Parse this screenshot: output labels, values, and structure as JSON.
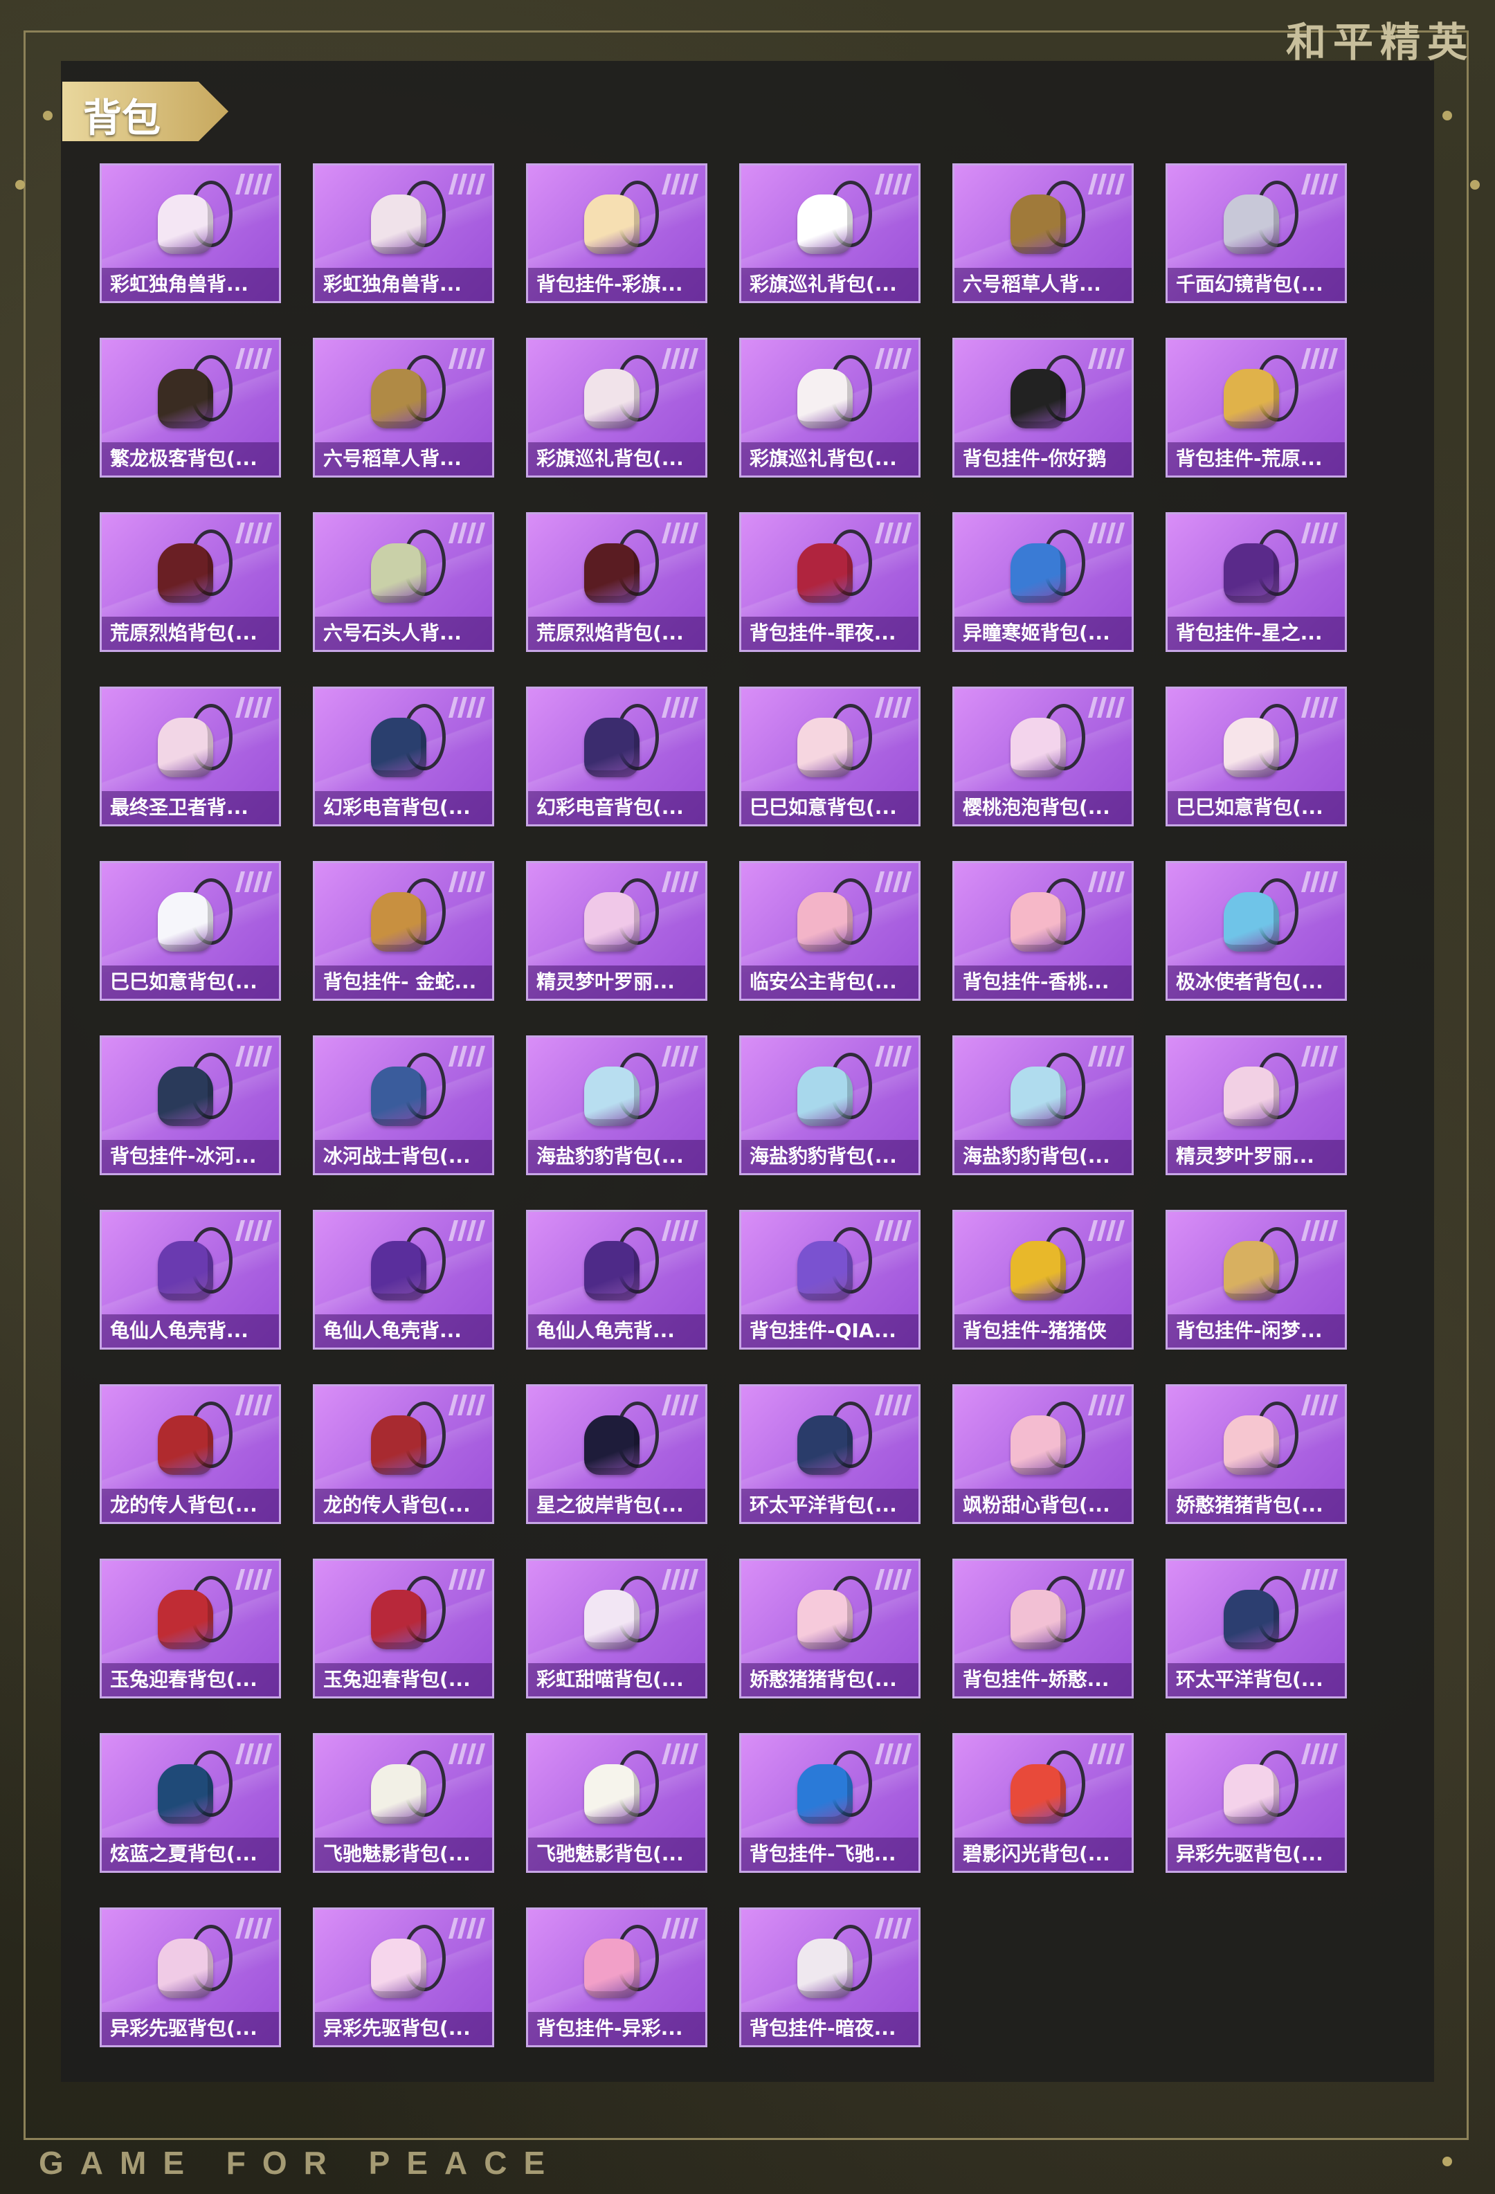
{
  "brand_cn": "和平精英",
  "footer_en": "GAME FOR PEACE",
  "section": {
    "title": "背包"
  },
  "colors": {
    "card_top": "#d98ef7",
    "card_bottom": "#9a4fd7",
    "frame": "#8c8158",
    "gold": "#d4bd7a"
  },
  "items": [
    {
      "label": "彩虹独角兽背...",
      "icon": "unicorn-backpack-icon",
      "color": "#f4e6f4"
    },
    {
      "label": "彩虹独角兽背...",
      "icon": "unicorn-backpack-icon",
      "color": "#f0e2ea"
    },
    {
      "label": "背包挂件-彩旗...",
      "icon": "icecream-charm-icon",
      "color": "#f6dfb2"
    },
    {
      "label": "彩旗巡礼背包(...",
      "icon": "bunny-backpack-icon",
      "color": "#ffffff"
    },
    {
      "label": "六号稻草人背...",
      "icon": "scarecrow-backpack-icon",
      "color": "#a07a3a"
    },
    {
      "label": "千面幻镜背包(...",
      "icon": "mirror-backpack-icon",
      "color": "#c8c8d8"
    },
    {
      "label": "繁龙极客背包(...",
      "icon": "dragon-backpack-icon",
      "color": "#3a2c22"
    },
    {
      "label": "六号稻草人背...",
      "icon": "scarecrow-backpack-icon",
      "color": "#b08a45"
    },
    {
      "label": "彩旗巡礼背包(...",
      "icon": "bunny-backpack-icon",
      "color": "#f1e3ea"
    },
    {
      "label": "彩旗巡礼背包(...",
      "icon": "bunny-backpack-icon",
      "color": "#f6f0f2"
    },
    {
      "label": "背包挂件-你好鹅",
      "icon": "penguin-charm-icon",
      "color": "#222222"
    },
    {
      "label": "背包挂件-荒原...",
      "icon": "sun-charm-icon",
      "color": "#e0b24a"
    },
    {
      "label": "荒原烈焰背包(...",
      "icon": "flame-backpack-icon",
      "color": "#6a1f24"
    },
    {
      "label": "六号石头人背...",
      "icon": "stone-backpack-icon",
      "color": "#c9d0a8"
    },
    {
      "label": "荒原烈焰背包(...",
      "icon": "flame-backpack-icon",
      "color": "#5a1c22"
    },
    {
      "label": "背包挂件-罪夜...",
      "icon": "heart-wing-charm-icon",
      "color": "#b0243e"
    },
    {
      "label": "异瞳寒姬背包(...",
      "icon": "ice-princess-backpack-icon",
      "color": "#3a7bd5"
    },
    {
      "label": "背包挂件-星之...",
      "icon": "planet-charm-icon",
      "color": "#5a2a8a"
    },
    {
      "label": "最终圣卫者背...",
      "icon": "winged-backpack-icon",
      "color": "#f2d6e6"
    },
    {
      "label": "幻彩电音背包(...",
      "icon": "speaker-backpack-icon",
      "color": "#2a3f6e"
    },
    {
      "label": "幻彩电音背包(...",
      "icon": "speaker-backpack-icon",
      "color": "#3b2c6e"
    },
    {
      "label": "巳巳如意背包(...",
      "icon": "snake-backpack-icon",
      "color": "#f6d6e0"
    },
    {
      "label": "樱桃泡泡背包(...",
      "icon": "bow-backpack-icon",
      "color": "#f3d4ec"
    },
    {
      "label": "巳巳如意背包(...",
      "icon": "snake-backpack-icon",
      "color": "#f7e4ea"
    },
    {
      "label": "巳巳如意背包(...",
      "icon": "bunny-backpack-icon",
      "color": "#f6f6fb"
    },
    {
      "label": "背包挂件- 金蛇...",
      "icon": "golden-snake-charm-icon",
      "color": "#c89040"
    },
    {
      "label": "精灵梦叶罗丽...",
      "icon": "heart-backpack-icon",
      "color": "#f0c8e8"
    },
    {
      "label": "临安公主背包(...",
      "icon": "flower-backpack-icon",
      "color": "#f3b4c8"
    },
    {
      "label": "背包挂件-香桃...",
      "icon": "peach-blossom-charm-icon",
      "color": "#f6b8c8"
    },
    {
      "label": "极冰使者背包(...",
      "icon": "ice-crystal-backpack-icon",
      "color": "#6fc4e8"
    },
    {
      "label": "背包挂件-冰河...",
      "icon": "robot-charm-icon",
      "color": "#2a3a5a"
    },
    {
      "label": "冰河战士背包(...",
      "icon": "warrior-backpack-icon",
      "color": "#3a5c9c"
    },
    {
      "label": "海盐豹豹背包(...",
      "icon": "seal-backpack-icon",
      "color": "#b8def0"
    },
    {
      "label": "海盐豹豹背包(...",
      "icon": "seal-backpack-icon",
      "color": "#a8d8ec"
    },
    {
      "label": "海盐豹豹背包(...",
      "icon": "seal-backpack-icon",
      "color": "#b0dcee"
    },
    {
      "label": "精灵梦叶罗丽...",
      "icon": "heart-backpack-icon",
      "color": "#f2d0e4"
    },
    {
      "label": "龟仙人龟壳背...",
      "icon": "turtle-shell-backpack-icon",
      "color": "#6a3ab0"
    },
    {
      "label": "龟仙人龟壳背...",
      "icon": "turtle-shell-backpack-icon",
      "color": "#5a2e9c"
    },
    {
      "label": "龟仙人龟壳背...",
      "icon": "turtle-shell-backpack-icon",
      "color": "#4e2a88"
    },
    {
      "label": "背包挂件-QIA...",
      "icon": "gem-charm-icon",
      "color": "#7a52d0"
    },
    {
      "label": "背包挂件-猪猪侠",
      "icon": "pig-hero-charm-icon",
      "color": "#e8b82a"
    },
    {
      "label": "背包挂件-闲梦...",
      "icon": "hairpin-charm-icon",
      "color": "#d8b060"
    },
    {
      "label": "龙的传人背包(...",
      "icon": "dragon-heir-backpack-icon",
      "color": "#b02a2e"
    },
    {
      "label": "龙的传人背包(...",
      "icon": "dragon-heir-backpack-icon",
      "color": "#a82a30"
    },
    {
      "label": "星之彼岸背包(...",
      "icon": "star-shore-backpack-icon",
      "color": "#1e1c3a"
    },
    {
      "label": "环太平洋背包(...",
      "icon": "mech-backpack-icon",
      "color": "#2a3c6a"
    },
    {
      "label": "飒粉甜心背包(...",
      "icon": "pink-sweetheart-backpack-icon",
      "color": "#f4bcd0"
    },
    {
      "label": "娇憨猪猪背包(...",
      "icon": "pig-backpack-icon",
      "color": "#f6c6d0"
    },
    {
      "label": "玉兔迎春背包(...",
      "icon": "jade-rabbit-backpack-icon",
      "color": "#c02c34"
    },
    {
      "label": "玉兔迎春背包(...",
      "icon": "jade-rabbit-backpack-icon",
      "color": "#b8283a"
    },
    {
      "label": "彩虹甜喵背包(...",
      "icon": "cat-backpack-icon",
      "color": "#f2e6f4"
    },
    {
      "label": "娇憨猪猪背包(...",
      "icon": "pig-backpack-icon",
      "color": "#f6cadb"
    },
    {
      "label": "背包挂件-娇憨...",
      "icon": "pig-charm-icon",
      "color": "#f2c0d4"
    },
    {
      "label": "环太平洋背包(...",
      "icon": "mech-backpack-icon",
      "color": "#2c3e70"
    },
    {
      "label": "炫蓝之夏背包(...",
      "icon": "blue-summer-backpack-icon",
      "color": "#1f4a78"
    },
    {
      "label": "飞驰魅影背包(...",
      "icon": "speed-backpack-icon",
      "color": "#f2f0e6"
    },
    {
      "label": "飞驰魅影背包(...",
      "icon": "speed-backpack-icon",
      "color": "#f6f4ec"
    },
    {
      "label": "背包挂件-飞驰...",
      "icon": "eye-wing-charm-icon",
      "color": "#2a7ad8"
    },
    {
      "label": "碧影闪光背包(...",
      "icon": "gamepad-backpack-icon",
      "color": "#e84a3a"
    },
    {
      "label": "异彩先驱背包(...",
      "icon": "bunny-face-backpack-icon",
      "color": "#f4d2ea"
    },
    {
      "label": "异彩先驱背包(...",
      "icon": "bunny-face-backpack-icon",
      "color": "#f0cbe6"
    },
    {
      "label": "异彩先驱背包(...",
      "icon": "bunny-face-backpack-icon",
      "color": "#f6d6ec"
    },
    {
      "label": "背包挂件-异彩...",
      "icon": "roller-skate-charm-icon",
      "color": "#f2a0c8"
    },
    {
      "label": "背包挂件-暗夜...",
      "icon": "dark-bunny-charm-icon",
      "color": "#efe8ef"
    }
  ]
}
